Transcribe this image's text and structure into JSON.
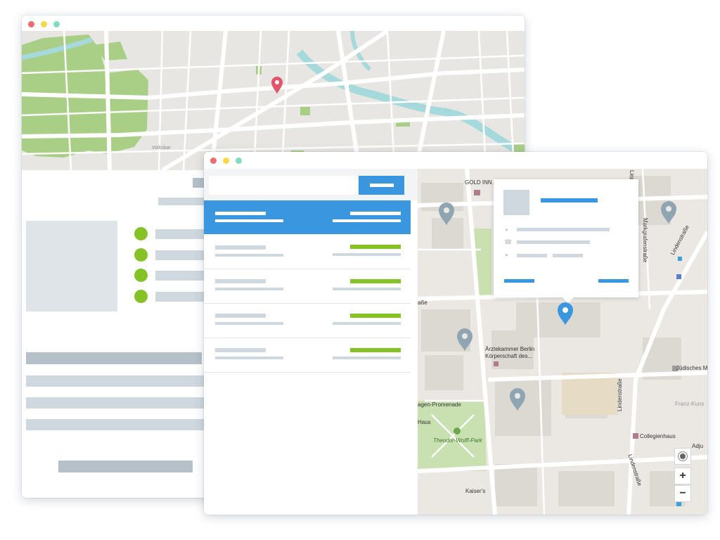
{
  "colors": {
    "accent_blue": "#3a97df",
    "accent_green": "#85c226",
    "placeholder_gray": "#cfd8df",
    "placeholder_dark": "#b5c0c8",
    "park_green": "#a9cf86",
    "water": "#a6d9dc",
    "pin_red": "#e0556a",
    "pin_gray": "#8fa5b2"
  },
  "front_map": {
    "labels": {
      "hotel": "GOLD INN A",
      "street_strasse_fragment": "aße",
      "aerztekammer_1": "Ärztekammer Berlin",
      "aerztekammer_2": "Körperschaft des...",
      "promenade": "agen-Promenade",
      "haus": "Haus",
      "park": "Theodor-Wolff-Park",
      "kaisers": "Kaiser's",
      "juedisches": "Jüdisches M",
      "franz": "Franz-Kuns",
      "collegienhaus": "Collegienhaus",
      "lindenstrasse_1": "Lindenstraße",
      "lindenstrasse_2": "Lindenstraße",
      "lindenstrasse_3": "Lindenstraße",
      "markgrafenstrasse": "Markgrafenstraße",
      "adjunct": "Adju"
    },
    "controls": {
      "locate_icon": "crosshair-icon",
      "zoom_in": "+",
      "zoom_out": "−"
    }
  },
  "back_map": {
    "labels": {
      "street": "Volksbar"
    }
  }
}
